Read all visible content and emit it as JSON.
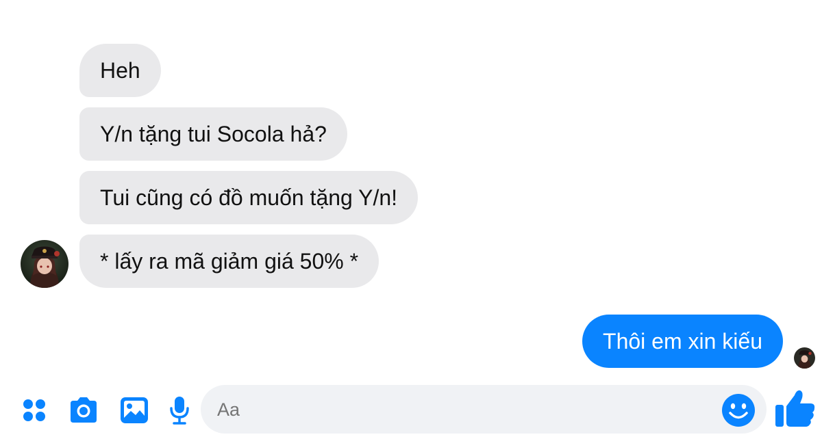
{
  "messages_in": [
    {
      "text": "Heh"
    },
    {
      "text": "Y/n tặng tui Socola hả?"
    },
    {
      "text": "Tui cũng có đồ muốn tặng Y/n!"
    },
    {
      "text": "* lấy ra mã giảm giá 50% *"
    }
  ],
  "messages_out": [
    {
      "text": "Thôi em xin kiếu"
    }
  ],
  "composer": {
    "placeholder": "Aa"
  },
  "toolbar": {
    "icons": [
      "apps-grid-icon",
      "camera-icon",
      "image-icon",
      "microphone-icon",
      "emoji-icon",
      "thumbs-up-icon"
    ]
  },
  "colors": {
    "accent": "#0a84ff",
    "incoming_bubble": "#e9e9eb",
    "composer_bg": "#f0f2f5"
  }
}
